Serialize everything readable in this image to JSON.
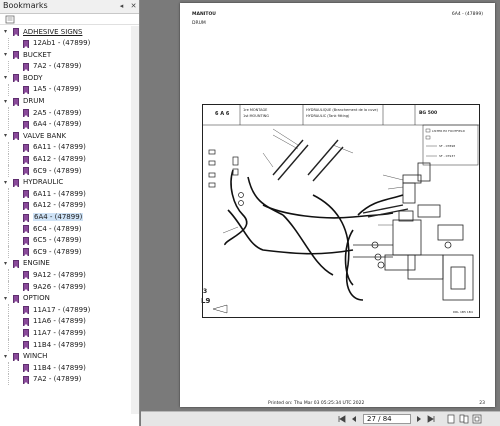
{
  "panel": {
    "title": "Bookmarks",
    "controls": [
      "◂",
      "✕"
    ]
  },
  "bookmarks": [
    {
      "label": "ADHESIVE SIGNS",
      "children": [
        "12Ab1 - (47899)"
      ]
    },
    {
      "label": "BUCKET",
      "children": [
        "7A2 - (47899)"
      ]
    },
    {
      "label": "BODY",
      "children": [
        "1A5 - (47899)"
      ]
    },
    {
      "label": "DRUM",
      "children": [
        "2A5 - (47899)",
        "6A4 - (47899)"
      ]
    },
    {
      "label": "VALVE BANK",
      "children": [
        "6A11 - (47899)",
        "6A12 - (47899)",
        "6C9 - (47899)"
      ]
    },
    {
      "label": "HYDRAULIC",
      "children": [
        "6A11 - (47899)",
        "6A12 - (47899)",
        "6A4 - (47899)",
        "6C4 - (47899)",
        "6C5 - (47899)",
        "6C9 - (47899)"
      ]
    },
    {
      "label": "ENGINE",
      "children": [
        "9A12 - (47899)",
        "9A26 - (47899)"
      ]
    },
    {
      "label": "OPTION",
      "children": [
        "11A17 - (47899)",
        "11A6 - (47899)",
        "11A7 - (47899)",
        "11B4 - (47899)"
      ]
    },
    {
      "label": "WINCH",
      "children": [
        "11B4 - (47899)",
        "7A2 - (47899)"
      ]
    }
  ],
  "document": {
    "header_left": "MANITOU",
    "header_right": "6A4 - (47899)",
    "section": "DRUM",
    "table_code": "6 A 6",
    "mount_1": "1re MONTAGE",
    "mount_2": "1st MOUNTING",
    "caption_fr": "HYDRAULIQUE (Branchement de la cuve)",
    "caption_en": "HYDRAULIC (Tank fitting)",
    "model": "BG 500",
    "legend_1": "LISTER EX FOOTFIELD",
    "legend_2": "SF - 07898",
    "legend_3": "SF - 07937",
    "page_num_label": "3",
    "page_code": "L9",
    "bottom_code": "DRL 1B5 1B4",
    "footer_printed": "Printed on:  Thu Mar 03 05:25:34 UTC 2022",
    "footer_page": "23"
  },
  "navigation": {
    "current_page": "27",
    "total_pages": "84",
    "page_display": "27 / 84"
  },
  "colors": {
    "bookmark_icon": "#8a4a9a",
    "selected_bg": "#cfe3f7",
    "panel_bg": "#ffffff",
    "viewer_bg": "#7a7a7a"
  }
}
